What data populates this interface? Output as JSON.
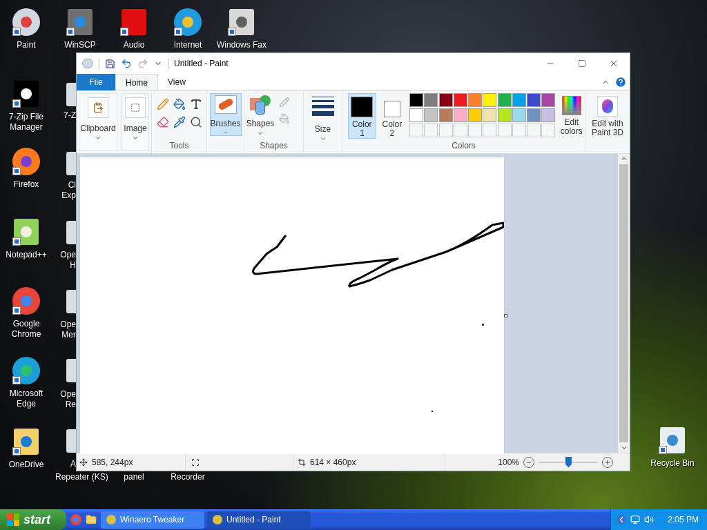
{
  "desktop_icons": [
    {
      "lines": [
        "Paint"
      ]
    },
    {
      "lines": [
        "WinSCP"
      ]
    },
    {
      "lines": [
        "Audio"
      ]
    },
    {
      "lines": [
        "Internet"
      ]
    },
    {
      "lines": [
        "Windows Fax"
      ]
    },
    {
      "lines": [
        "7-Zip File",
        "Manager"
      ]
    },
    {
      "lines": [
        "Firefox"
      ]
    },
    {
      "lines": [
        "Notepad++"
      ]
    },
    {
      "lines": [
        "Google",
        "Chrome"
      ]
    },
    {
      "lines": [
        "Microsoft",
        "Edge"
      ]
    },
    {
      "lines": [
        "OneDrive"
      ]
    },
    {
      "lines": [
        "Recycle Bin"
      ]
    }
  ],
  "covered_icons": [
    {
      "lines": [
        "7-Z"
      ]
    },
    {
      "lines": [
        "Cl",
        "Exp"
      ]
    },
    {
      "lines": [
        "Ope",
        "H"
      ]
    },
    {
      "lines": [
        "Ope",
        "Mer"
      ]
    },
    {
      "lines": [
        "Ope",
        "Re"
      ]
    },
    {
      "lines": [
        "A",
        "Repeater (KS)"
      ]
    },
    {
      "lines": [
        "panel"
      ]
    },
    {
      "lines": [
        "Recorder"
      ]
    }
  ],
  "window": {
    "title": "Untitled - Paint",
    "tabs": [
      {
        "label": "File",
        "kind": "file",
        "selected": false
      },
      {
        "label": "Home",
        "kind": "tab",
        "selected": true
      },
      {
        "label": "View",
        "kind": "tab",
        "selected": false
      }
    ],
    "ribbon": {
      "clipboard": "Clipboard",
      "image": "Image",
      "tools_label": "Tools",
      "brushes": {
        "label": "Brushes",
        "selected": true
      },
      "shapes": "Shapes",
      "shapes_label": "Shapes",
      "size": "Size",
      "color1": {
        "label": "Color",
        "sub": "1",
        "color": "#000000",
        "selected": true
      },
      "color2": {
        "label": "Color",
        "sub": "2",
        "color": "#ffffff",
        "selected": false
      },
      "palette": [
        {
          "color": "#000000"
        },
        {
          "color": "#7f7f7f"
        },
        {
          "color": "#880015"
        },
        {
          "color": "#ed1c24"
        },
        {
          "color": "#ff7f27"
        },
        {
          "color": "#fff200"
        },
        {
          "color": "#22b14c"
        },
        {
          "color": "#00a2e8"
        },
        {
          "color": "#3f48cc"
        },
        {
          "color": "#a349a4"
        },
        {
          "color": "#ffffff"
        },
        {
          "color": "#c3c3c3"
        },
        {
          "color": "#b97a57"
        },
        {
          "color": "#ffaec9"
        },
        {
          "color": "#ffc90e"
        },
        {
          "color": "#efe4b0"
        },
        {
          "color": "#b5e61d"
        },
        {
          "color": "#99d9ea"
        },
        {
          "color": "#7092be"
        },
        {
          "color": "#c8bfe7"
        }
      ],
      "colors_label": "Colors",
      "edit_colors": [
        "Edit",
        "colors"
      ],
      "paint3d": [
        "Edit with",
        "Paint 3D"
      ]
    },
    "status_bar": {
      "cursor": "585, 244px",
      "size": "614 × 460px",
      "zoom": "100%",
      "zoom_slider": {
        "level": 0.5
      }
    }
  },
  "taskbar": {
    "start": "start",
    "tasks": [
      {
        "label": "Winaero Tweaker",
        "selected": false
      },
      {
        "label": "Untitled - Paint",
        "selected": true
      }
    ],
    "time": "2:05 PM"
  }
}
